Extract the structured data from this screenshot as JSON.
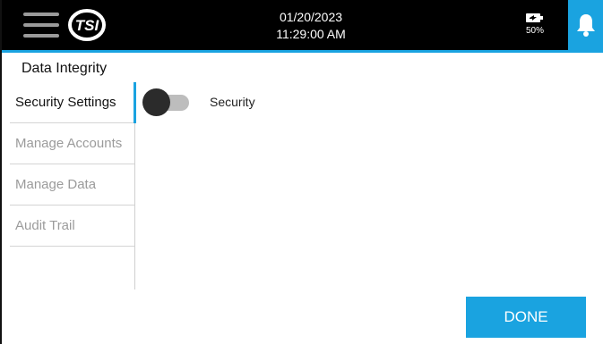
{
  "header": {
    "date": "01/20/2023",
    "time": "11:29:00 AM",
    "battery_percent": "50%",
    "logo_text": "TSI",
    "accent_color": "#1aa3e0"
  },
  "page": {
    "title": "Data Integrity"
  },
  "sidebar": {
    "items": [
      {
        "label": "Security Settings",
        "active": true
      },
      {
        "label": "Manage Accounts",
        "active": false
      },
      {
        "label": "Manage Data",
        "active": false
      },
      {
        "label": "Audit Trail",
        "active": false
      }
    ]
  },
  "settings": {
    "security_label": "Security",
    "security_enabled": false
  },
  "actions": {
    "done_label": "DONE"
  },
  "icons": {
    "menu": "hamburger-menu-icon",
    "battery": "battery-charging-icon",
    "notifications": "bell-icon"
  }
}
